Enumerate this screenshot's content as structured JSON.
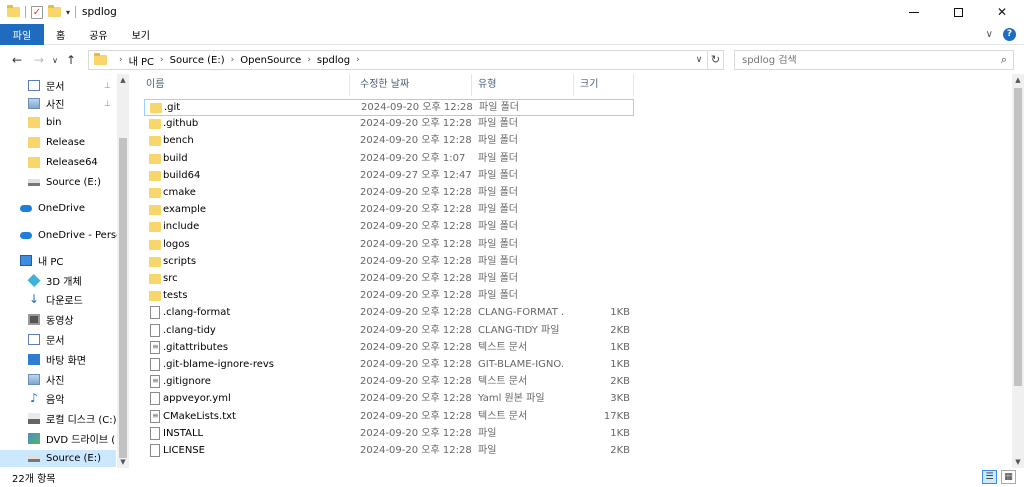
{
  "window": {
    "title": "spdlog",
    "minimize_glyph": "—",
    "maximize_glyph": "☐",
    "close_glyph": "✕"
  },
  "ribbon": {
    "tabs": [
      "파일",
      "홈",
      "공유",
      "보기"
    ],
    "expand_glyph": "∨",
    "help_glyph": "?"
  },
  "nav": {
    "back_glyph": "←",
    "forward_glyph": "→",
    "recent_glyph": "∨",
    "up_glyph": "↑"
  },
  "address": {
    "crumbs": [
      "내 PC",
      "Source (E:)",
      "OpenSource",
      "spdlog"
    ],
    "dropdown_glyph": "∨",
    "refresh_glyph": "↻"
  },
  "search": {
    "placeholder": "spdlog 검색",
    "icon_glyph": "⌕"
  },
  "navpane": {
    "items": [
      {
        "label": "문서",
        "icon": "document-icon",
        "pinned": true
      },
      {
        "label": "사진",
        "icon": "picture-icon",
        "pinned": true
      },
      {
        "label": "bin",
        "icon": "folder-icon"
      },
      {
        "label": "Release",
        "icon": "folder-icon"
      },
      {
        "label": "Release64",
        "icon": "folder-icon"
      },
      {
        "label": "Source (E:)",
        "icon": "drive-icon"
      },
      {
        "label": "OneDrive",
        "icon": "cloud-icon"
      },
      {
        "label": "OneDrive - Person",
        "icon": "cloud-icon"
      },
      {
        "label": "내 PC",
        "icon": "pc-icon"
      },
      {
        "label": "3D 개체",
        "icon": "objects-3d-icon"
      },
      {
        "label": "다운로드",
        "icon": "download-icon"
      },
      {
        "label": "동영상",
        "icon": "video-icon"
      },
      {
        "label": "문서",
        "icon": "document-icon"
      },
      {
        "label": "바탕 화면",
        "icon": "desktop-icon"
      },
      {
        "label": "사진",
        "icon": "picture-icon"
      },
      {
        "label": "음악",
        "icon": "music-icon"
      },
      {
        "label": "로컬 디스크 (C:)",
        "icon": "local-disk-icon"
      },
      {
        "label": "DVD 드라이브 (",
        "icon": "dvd-icon"
      },
      {
        "label": "Source (E:)",
        "icon": "drive-icon",
        "selected": true
      }
    ],
    "pin_glyph": "📌"
  },
  "columns": {
    "name": "이름",
    "date": "수정한 날짜",
    "type": "유형",
    "size": "크기"
  },
  "files": [
    {
      "name": ".git",
      "date": "2024-09-20 오후 12:28",
      "type": "파일 폴더",
      "size": "",
      "kind": "folder"
    },
    {
      "name": ".github",
      "date": "2024-09-20 오후 12:28",
      "type": "파일 폴더",
      "size": "",
      "kind": "folder"
    },
    {
      "name": "bench",
      "date": "2024-09-20 오후 12:28",
      "type": "파일 폴더",
      "size": "",
      "kind": "folder"
    },
    {
      "name": "build",
      "date": "2024-09-20 오후 1:07",
      "type": "파일 폴더",
      "size": "",
      "kind": "folder"
    },
    {
      "name": "build64",
      "date": "2024-09-27 오후 12:47",
      "type": "파일 폴더",
      "size": "",
      "kind": "folder"
    },
    {
      "name": "cmake",
      "date": "2024-09-20 오후 12:28",
      "type": "파일 폴더",
      "size": "",
      "kind": "folder"
    },
    {
      "name": "example",
      "date": "2024-09-20 오후 12:28",
      "type": "파일 폴더",
      "size": "",
      "kind": "folder"
    },
    {
      "name": "include",
      "date": "2024-09-20 오후 12:28",
      "type": "파일 폴더",
      "size": "",
      "kind": "folder"
    },
    {
      "name": "logos",
      "date": "2024-09-20 오후 12:28",
      "type": "파일 폴더",
      "size": "",
      "kind": "folder"
    },
    {
      "name": "scripts",
      "date": "2024-09-20 오후 12:28",
      "type": "파일 폴더",
      "size": "",
      "kind": "folder"
    },
    {
      "name": "src",
      "date": "2024-09-20 오후 12:28",
      "type": "파일 폴더",
      "size": "",
      "kind": "folder"
    },
    {
      "name": "tests",
      "date": "2024-09-20 오후 12:28",
      "type": "파일 폴더",
      "size": "",
      "kind": "folder"
    },
    {
      "name": ".clang-format",
      "date": "2024-09-20 오후 12:28",
      "type": "CLANG-FORMAT ...",
      "size": "1KB",
      "kind": "file"
    },
    {
      "name": ".clang-tidy",
      "date": "2024-09-20 오후 12:28",
      "type": "CLANG-TIDY 파일",
      "size": "2KB",
      "kind": "file"
    },
    {
      "name": ".gitattributes",
      "date": "2024-09-20 오후 12:28",
      "type": "텍스트 문서",
      "size": "1KB",
      "kind": "text"
    },
    {
      "name": ".git-blame-ignore-revs",
      "date": "2024-09-20 오후 12:28",
      "type": "GIT-BLAME-IGNO...",
      "size": "1KB",
      "kind": "file"
    },
    {
      "name": ".gitignore",
      "date": "2024-09-20 오후 12:28",
      "type": "텍스트 문서",
      "size": "2KB",
      "kind": "text"
    },
    {
      "name": "appveyor.yml",
      "date": "2024-09-20 오후 12:28",
      "type": "Yaml 원본 파일",
      "size": "3KB",
      "kind": "file"
    },
    {
      "name": "CMakeLists.txt",
      "date": "2024-09-20 오후 12:28",
      "type": "텍스트 문서",
      "size": "17KB",
      "kind": "text"
    },
    {
      "name": "INSTALL",
      "date": "2024-09-20 오후 12:28",
      "type": "파일",
      "size": "1KB",
      "kind": "file"
    },
    {
      "name": "LICENSE",
      "date": "2024-09-20 오후 12:28",
      "type": "파일",
      "size": "2KB",
      "kind": "file"
    }
  ],
  "selected_file_index": 0,
  "status": {
    "item_count": "22개 항목"
  },
  "colors": {
    "accent": "#1e6bbf",
    "selection": "#cce8ff",
    "folder": "#f9d66c"
  }
}
